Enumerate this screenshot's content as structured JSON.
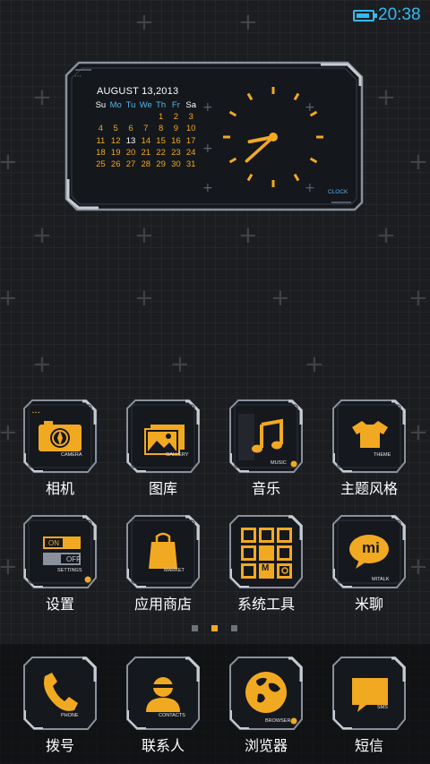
{
  "status_bar": {
    "time": "20:38",
    "battery_level": 0.85,
    "accent": "#35b9ee"
  },
  "widget": {
    "calendar": {
      "title": "AUGUST  13,2013",
      "weekdays": [
        "Su",
        "Mo",
        "Tu",
        "We",
        "Th",
        "Fr",
        "Sa"
      ],
      "weeks": [
        [
          "",
          "",
          "",
          "",
          "1",
          "2",
          "3"
        ],
        [
          "4",
          "5",
          "6",
          "7",
          "8",
          "9",
          "10"
        ],
        [
          "11",
          "12",
          "13",
          "14",
          "15",
          "16",
          "17"
        ],
        [
          "18",
          "19",
          "20",
          "21",
          "22",
          "23",
          "24"
        ],
        [
          "25",
          "26",
          "27",
          "28",
          "29",
          "30",
          "31"
        ]
      ],
      "today": "13"
    },
    "clock": {
      "label": "CLOCK",
      "hour": 8,
      "minute": 38
    }
  },
  "apps": {
    "camera": {
      "label": "相机",
      "tag": "CAMERA",
      "icon": "camera-icon"
    },
    "gallery": {
      "label": "图库",
      "tag": "GALLERY",
      "icon": "gallery-icon"
    },
    "music": {
      "label": "音乐",
      "tag": "MUSIC",
      "icon": "music-note-icon"
    },
    "theme": {
      "label": "主题风格",
      "tag": "THEME",
      "icon": "tshirt-icon"
    },
    "settings": {
      "label": "设置",
      "tag": "SETTINGS",
      "icon": "toggle-switch-icon",
      "on": "ON",
      "off": "OFF"
    },
    "market": {
      "label": "应用商店",
      "tag": "MARKET",
      "icon": "shopping-bag-icon"
    },
    "tools": {
      "label": "系统工具",
      "icon": "tools-grid-icon",
      "m": "M"
    },
    "mitalk": {
      "label": "米聊",
      "tag": "MITALK",
      "icon": "chat-bubble-icon",
      "mi": "mi"
    }
  },
  "dock": {
    "phone": {
      "label": "拨号",
      "tag": "PHONE",
      "icon": "phone-icon"
    },
    "contacts": {
      "label": "联系人",
      "tag": "CONTACTS",
      "icon": "person-icon"
    },
    "browser": {
      "label": "浏览器",
      "tag": "BROWSER",
      "icon": "globe-icon"
    },
    "sms": {
      "label": "短信",
      "tag": "SMS",
      "icon": "message-icon"
    }
  },
  "pager": {
    "pages": 3,
    "current": 2
  },
  "colors": {
    "accent": "#f2a922",
    "frame": "#8a919c",
    "tile_bg": "#15181d",
    "blue": "#4fb8f0"
  }
}
